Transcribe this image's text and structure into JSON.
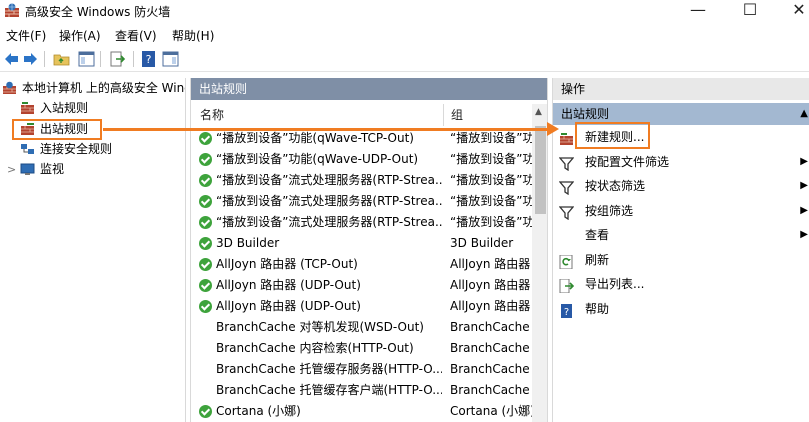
{
  "window": {
    "title": "高级安全 Windows 防火墙",
    "minimize_glyph": "—",
    "maximize_glyph": "☐",
    "close_glyph": "✕"
  },
  "menubar": [
    "文件(F)",
    "操作(A)",
    "查看(V)",
    "帮助(H)"
  ],
  "tree": {
    "root": "本地计算机 上的高级安全 Wind",
    "items": [
      "入站规则",
      "出站规则",
      "连接安全规则",
      "监视"
    ]
  },
  "list": {
    "panel_title": "出站规则",
    "col_name": "名称",
    "col_group": "组",
    "rows": [
      {
        "name": "“播放到设备”功能(qWave-TCP-Out)",
        "group": "“播放到设备”功",
        "enabled": true
      },
      {
        "name": "“播放到设备”功能(qWave-UDP-Out)",
        "group": "“播放到设备”功",
        "enabled": true
      },
      {
        "name": "“播放到设备”流式处理服务器(RTP-Strea...",
        "group": "“播放到设备”功",
        "enabled": true
      },
      {
        "name": "“播放到设备”流式处理服务器(RTP-Strea...",
        "group": "“播放到设备”功",
        "enabled": true
      },
      {
        "name": "“播放到设备”流式处理服务器(RTP-Strea...",
        "group": "“播放到设备”功",
        "enabled": true
      },
      {
        "name": "3D Builder",
        "group": "3D Builder",
        "enabled": true
      },
      {
        "name": "AllJoyn 路由器 (TCP-Out)",
        "group": "AllJoyn 路由器",
        "enabled": true
      },
      {
        "name": "AllJoyn 路由器 (UDP-Out)",
        "group": "AllJoyn 路由器",
        "enabled": true
      },
      {
        "name": "AllJoyn 路由器 (UDP-Out)",
        "group": "AllJoyn 路由器",
        "enabled": true
      },
      {
        "name": "BranchCache 对等机发现(WSD-Out)",
        "group": "BranchCache -",
        "enabled": false
      },
      {
        "name": "BranchCache 内容检索(HTTP-Out)",
        "group": "BranchCache -",
        "enabled": false
      },
      {
        "name": "BranchCache 托管缓存服务器(HTTP-O...",
        "group": "BranchCache -",
        "enabled": false
      },
      {
        "name": "BranchCache 托管缓存客户端(HTTP-O...",
        "group": "BranchCache -",
        "enabled": false
      },
      {
        "name": "Cortana (小娜)",
        "group": "Cortana (小娜)",
        "enabled": true
      }
    ]
  },
  "actions": {
    "header": "操作",
    "section": "出站规则",
    "items": [
      {
        "label": "新建规则...",
        "icon": "new-rule-icon",
        "submenu": false
      },
      {
        "label": "按配置文件筛选",
        "icon": "filter-icon",
        "submenu": true
      },
      {
        "label": "按状态筛选",
        "icon": "filter-icon",
        "submenu": true
      },
      {
        "label": "按组筛选",
        "icon": "filter-icon",
        "submenu": true
      },
      {
        "label": "查看",
        "icon": "",
        "submenu": true
      },
      {
        "label": "刷新",
        "icon": "refresh-icon",
        "submenu": false
      },
      {
        "label": "导出列表...",
        "icon": "export-icon",
        "submenu": false
      },
      {
        "label": "帮助",
        "icon": "help-icon",
        "submenu": false
      }
    ]
  },
  "colors": {
    "accent_orange": "#f07c22",
    "panel_header": "#7f8fa6",
    "section_header": "#a3b8d1",
    "enabled_green": "#3ea33c"
  }
}
